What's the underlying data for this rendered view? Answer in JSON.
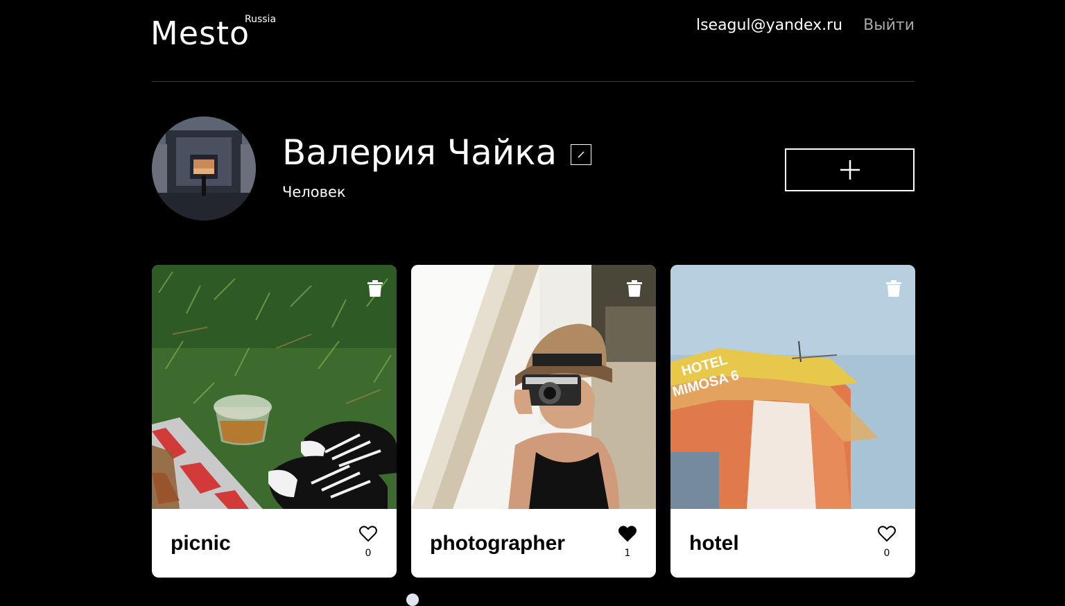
{
  "header": {
    "logo_text": "Mesto",
    "logo_sup": "Russia",
    "email": "lseagul@yandex.ru",
    "logout_label": "Выйти"
  },
  "profile": {
    "name": "Валерия Чайка",
    "about": "Человек"
  },
  "cards": [
    {
      "title": "picnic",
      "likes": "0",
      "liked": false
    },
    {
      "title": "photographer",
      "likes": "1",
      "liked": true
    },
    {
      "title": "hotel",
      "likes": "0",
      "liked": false
    }
  ],
  "icons": {
    "edit": "pencil-icon",
    "add": "plus-icon",
    "trash": "trash-icon",
    "like": "heart-icon"
  },
  "colors": {
    "background": "#000000",
    "text": "#ffffff",
    "muted": "#a9a9a9",
    "card": "#ffffff"
  }
}
